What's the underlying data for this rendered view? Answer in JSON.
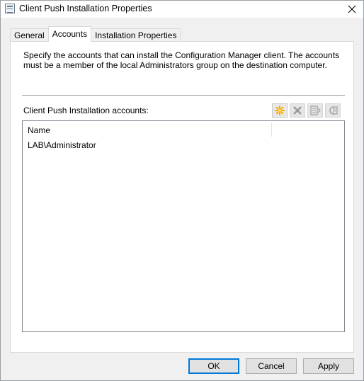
{
  "window": {
    "title": "Client Push Installation Properties"
  },
  "tabs": [
    {
      "label": "General",
      "active": false
    },
    {
      "label": "Accounts",
      "active": true
    },
    {
      "label": "Installation Properties",
      "active": false
    }
  ],
  "accounts_page": {
    "description": "Specify the accounts that can install the Configuration Manager client. The accounts must be a member of the local Administrators group on the destination computer.",
    "accounts_label": "Client Push Installation accounts:",
    "toolbar": [
      {
        "icon": "new-star-icon",
        "enabled": true
      },
      {
        "icon": "delete-x-icon",
        "enabled": false
      },
      {
        "icon": "properties-icon",
        "enabled": false
      },
      {
        "icon": "verify-icon",
        "enabled": false
      }
    ],
    "list": {
      "columns": [
        "Name",
        ""
      ],
      "rows": [
        "LAB\\Administrator"
      ]
    }
  },
  "buttons": {
    "ok": "OK",
    "cancel": "Cancel",
    "apply": "Apply"
  },
  "colors": {
    "accent": "#0078d7",
    "new_icon": "#f2a900"
  }
}
